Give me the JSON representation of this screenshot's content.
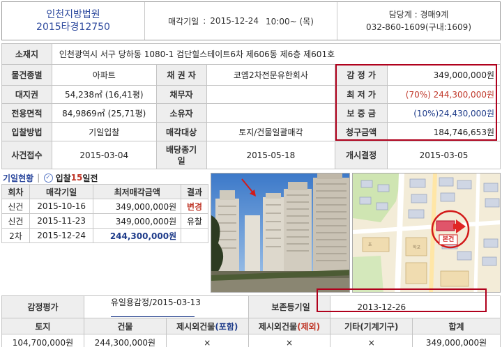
{
  "header": {
    "court": "인천지방법원",
    "case_no": "2015타경12750",
    "sale_date_label": "매각기일",
    "sale_date": "2015-12-24",
    "sale_time": "10:00~ (목)",
    "contact_label": "담당계",
    "contact_dept": "경매9계",
    "contact_phone": "032-860-1609(구내:1609)"
  },
  "property": {
    "location_label": "소재지",
    "location": "인천광역시 서구 당하동 1080-1 검단힐스테이트6차 제606동 제6층 제601호",
    "type_label": "물건종별",
    "type": "아파트",
    "creditor_label": "채 권 자",
    "creditor": "코엠2차전문유한회사",
    "appraisal_label": "감 정 가",
    "appraisal": "349,000,000원",
    "land_label": "대지권",
    "land": "54,238㎡ (16,41평)",
    "debtor_label": "채무자",
    "debtor": "",
    "min_price_label": "최 저 가",
    "min_price": "(70%) 244,300,000원",
    "area_label": "전용면적",
    "area": "84,9869㎡ (25,71평)",
    "owner_label": "소유자",
    "owner": "",
    "deposit_label": "보 증 금",
    "deposit": "(10%)24,430,000원",
    "method_label": "입찰방법",
    "method": "기일입찰",
    "target_label": "매각대상",
    "target": "토지/건물일괄매각",
    "claim_label": "청구금액",
    "claim": "184,746,653원",
    "received_label": "사건접수",
    "received": "2015-03-04",
    "dividend_label": "배당종기일",
    "dividend": "2015-05-18",
    "start_label": "개시결정",
    "start": "2015-03-05"
  },
  "history": {
    "title": "기일현황",
    "dday_prefix": "입찰",
    "dday_num": "15",
    "dday_suffix": "일전",
    "headers": [
      "회차",
      "매각기일",
      "최저매각금액",
      "결과"
    ],
    "rows": [
      {
        "round": "신건",
        "date": "2015-10-16",
        "price": "349,000,000원",
        "result": "변경"
      },
      {
        "round": "신건",
        "date": "2015-11-23",
        "price": "349,000,000원",
        "result": "유찰"
      },
      {
        "round": "2차",
        "date": "2015-12-24",
        "price": "244,300,000원",
        "result": ""
      }
    ]
  },
  "map": {
    "marker_label": "본건"
  },
  "appraisal_info": {
    "label": "감정평가",
    "value": "유일용감정/2015-03-13",
    "preserve_label": "보존등기일",
    "preserve_date": "2013-12-26",
    "col_headers": [
      "토지",
      "건물",
      "제시외건물",
      "(포함)",
      "제시외건물",
      "(제외)",
      "기타(기계기구)",
      "합계"
    ],
    "land": "104,700,000원",
    "building": "244,300,000원",
    "incl": "×",
    "excl": "×",
    "etc": "×",
    "total": "349,000,000원"
  },
  "colors": {
    "accent_red": "#b0001c",
    "link_blue": "#2e4a9e",
    "price_red": "#c0392b"
  }
}
